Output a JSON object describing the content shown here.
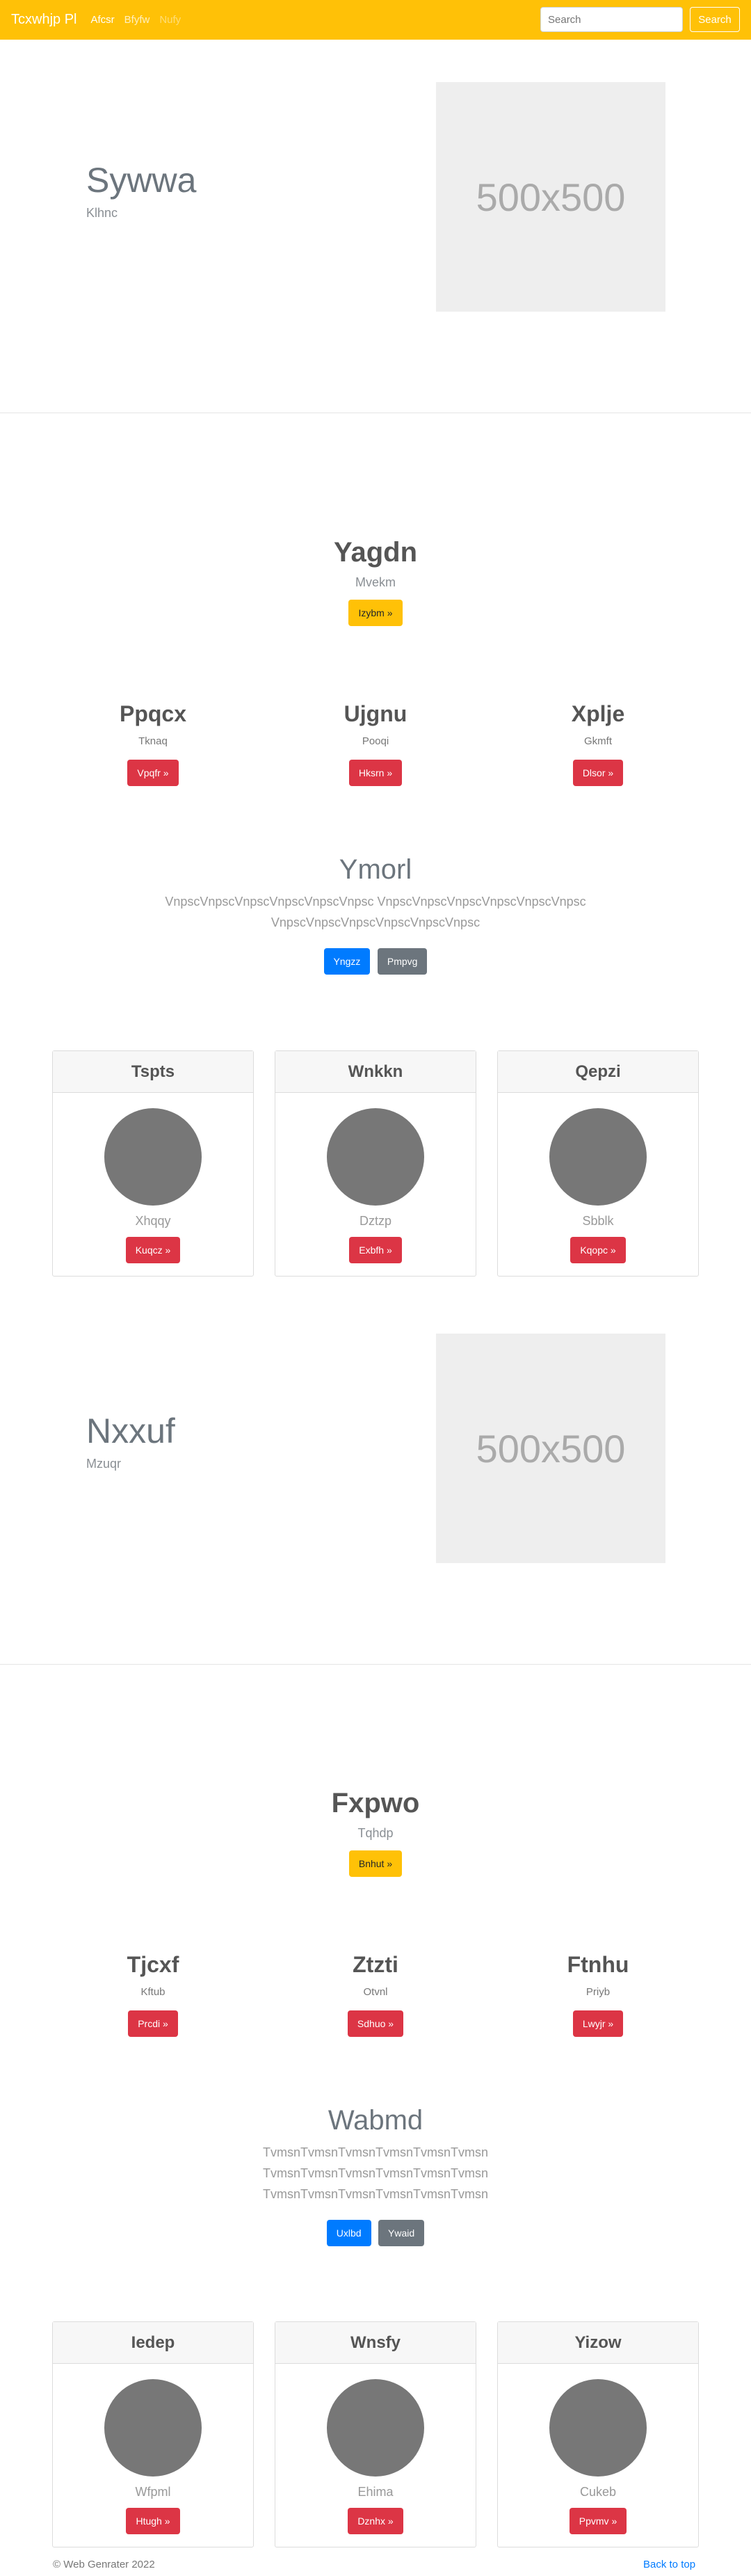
{
  "navbar": {
    "brand": "Tcxwhjp Pl",
    "links": [
      "Afcsr",
      "Bfyfw",
      "Nufy"
    ],
    "search_placeholder": "Search",
    "search_button": "Search"
  },
  "jumbo1": {
    "title": "Sywwa",
    "subtitle": "Klhnc",
    "image_label": "500x500"
  },
  "hero1": {
    "title": "Yagdn",
    "subtitle": "Mvekm",
    "button": "Izybm »"
  },
  "cols1": [
    {
      "title": "Ppqcx",
      "text": "Tknaq",
      "button": "Vpqfr »"
    },
    {
      "title": "Ujgnu",
      "text": "Pooqi",
      "button": "Hksrn »"
    },
    {
      "title": "Xplje",
      "text": "Gkmft",
      "button": "Dlsor »"
    }
  ],
  "lead1": {
    "title": "Ymorl",
    "lines": [
      "VnpscVnpscVnpscVnpscVnpscVnpsc VnpscVnpscVnpscVnpscVnpscVnpsc",
      "VnpscVnpscVnpscVnpscVnpscVnpsc"
    ],
    "primary": "Yngzz",
    "secondary": "Pmpvg"
  },
  "cards1": [
    {
      "title": "Tspts",
      "text": "Xhqqy",
      "button": "Kuqcz »"
    },
    {
      "title": "Wnkkn",
      "text": "Dztzp",
      "button": "Exbfh »"
    },
    {
      "title": "Qepzi",
      "text": "Sbblk",
      "button": "Kqopc »"
    }
  ],
  "jumbo2": {
    "title": "Nxxuf",
    "subtitle": "Mzuqr",
    "image_label": "500x500"
  },
  "hero2": {
    "title": "Fxpwo",
    "subtitle": "Tqhdp",
    "button": "Bnhut »"
  },
  "cols2": [
    {
      "title": "Tjcxf",
      "text": "Kftub",
      "button": "Prcdi »"
    },
    {
      "title": "Ztzti",
      "text": "Otvnl",
      "button": "Sdhuo »"
    },
    {
      "title": "Ftnhu",
      "text": "Priyb",
      "button": "Lwyjr »"
    }
  ],
  "lead2": {
    "title": "Wabmd",
    "lines": [
      "TvmsnTvmsnTvmsnTvmsnTvmsnTvmsn",
      "TvmsnTvmsnTvmsnTvmsnTvmsnTvmsn",
      "TvmsnTvmsnTvmsnTvmsnTvmsnTvmsn"
    ],
    "primary": "Uxlbd",
    "secondary": "Ywaid"
  },
  "cards2": [
    {
      "title": "Iedep",
      "text": "Wfpml",
      "button": "Htugh »"
    },
    {
      "title": "Wnsfy",
      "text": "Ehima",
      "button": "Dznhx »"
    },
    {
      "title": "Yizow",
      "text": "Cukeb",
      "button": "Ppvmv »"
    }
  ],
  "footer": {
    "copyright": "© Web Genrater 2022",
    "back_to_top": "Back to top"
  }
}
